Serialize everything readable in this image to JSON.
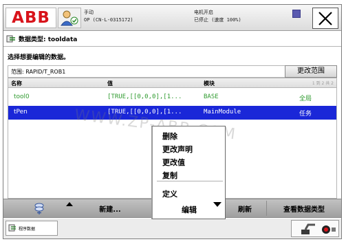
{
  "header": {
    "logo_text": "ABB",
    "mode": "手动",
    "controller": "OP (CN-L-0315172)",
    "motor_state": "电机开启",
    "run_state": "已停止 (速度 100%)"
  },
  "page": {
    "title": "数据类型: tooldata",
    "prompt": "选择想要编辑的数据。"
  },
  "scope": {
    "label": "范围: RAPID/T_ROB1",
    "change_button": "更改范围"
  },
  "table": {
    "columns": [
      "名称",
      "值",
      "模块"
    ],
    "pager": "1 到 2 共 2",
    "rows": [
      {
        "name": "tool0",
        "value": "[TRUE,[[0,0,0],[1...",
        "module": "BASE",
        "scope": "全局",
        "selected": false
      },
      {
        "name": "tPen",
        "value": "[TRUE,[[0,0,0],[1...",
        "module": "MainModule",
        "scope": "任务",
        "selected": true
      }
    ]
  },
  "watermark": "WWW.ZP-ABB.COM",
  "context_menu": {
    "items": [
      "删除",
      "更改声明",
      "更改值",
      "复制"
    ],
    "secondary": [
      "定义"
    ]
  },
  "commandbar": {
    "new": "新建...",
    "edit": "编辑",
    "refresh": "刷新",
    "view_type": "查看数据类型"
  },
  "taskbar": {
    "app_label": "程序数据"
  },
  "colors": {
    "abb_red": "#d8141b",
    "selection_blue": "#1a27d8",
    "row_green": "#2e9a2e"
  },
  "icons": [
    "user-icon",
    "quickset-icon",
    "close-icon",
    "data-icon",
    "toggle-icon",
    "arrow-up-icon",
    "dropdown-arrow-icon",
    "app-icon",
    "robot-icon"
  ]
}
